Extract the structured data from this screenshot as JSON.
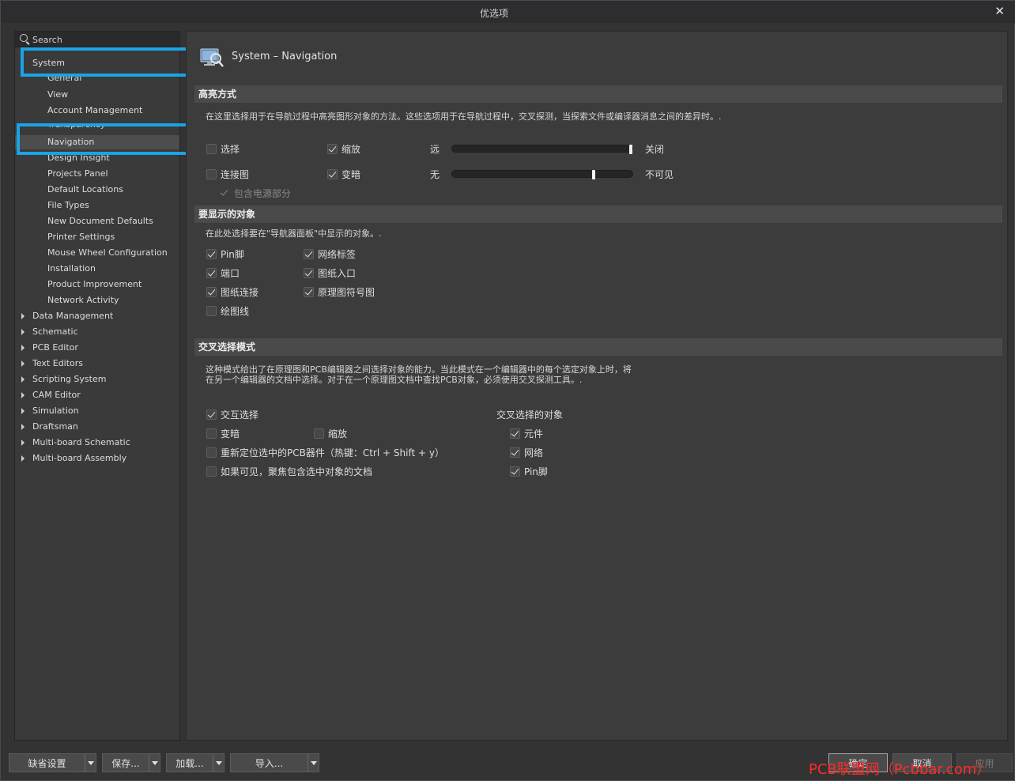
{
  "window": {
    "title": "优选项"
  },
  "search": {
    "placeholder": "Search"
  },
  "tree": {
    "system": "System",
    "children": [
      "General",
      "View",
      "Account Management",
      "Transparency",
      "Navigation",
      "Design Insight",
      "Projects Panel",
      "Default Locations",
      "File Types",
      "New Document Defaults",
      "Printer Settings",
      "Mouse Wheel Configuration",
      "Installation",
      "Product Improvement",
      "Network Activity"
    ],
    "roots": [
      "Data Management",
      "Schematic",
      "PCB Editor",
      "Text Editors",
      "Scripting System",
      "CAM Editor",
      "Simulation",
      "Draftsman",
      "Multi-board Schematic",
      "Multi-board Assembly"
    ]
  },
  "page": {
    "title": "System – Navigation"
  },
  "highlight": {
    "header": "高亮方式",
    "desc": "在这里选择用于在导航过程中高亮图形对象的方法。这些选项用于在导航过程中，交叉探测，当探索文件或编译器消息之间的差异时。.",
    "select": "选择",
    "zoom": "缩放",
    "connection": "连接图",
    "dim": "变暗",
    "far": "远",
    "off": "关闭",
    "none": "无",
    "invisible": "不可见",
    "include_power": "包含电源部分",
    "zoom_level": 1.0,
    "dim_level": 0.79
  },
  "objects": {
    "header": "要显示的对象",
    "desc": "在此处选择要在\"导航器面板\"中显示的对象。.",
    "pin": "Pin脚",
    "net_label": "网络标签",
    "port": "端口",
    "sheet_entry": "图纸入口",
    "sheet_connector": "图纸连接",
    "sheet_symbol": "原理图符号图",
    "graphic_line": "绘图线"
  },
  "cross": {
    "header": "交叉选择模式",
    "desc1": "这种模式给出了在原理图和PCB编辑器之间选择对象的能力。当此模式在一个编辑器中的每个选定对象上时，将",
    "desc2": "在另一个编辑器的文档中选择。对于在一个原理图文档中查找PCB对象，必须使用交叉探测工具。.",
    "interactive": "交互选择",
    "objects_title": "交叉选择的对象",
    "dim": "变暗",
    "zoom": "缩放",
    "component": "元件",
    "reposition": "重新定位选中的PCB器件（热键：Ctrl + Shift + y）",
    "net": "网络",
    "focus": "如果可见，聚焦包含选中对象的文档",
    "pin": "Pin脚"
  },
  "buttons": {
    "defaults": "缺省设置",
    "save": "保存...",
    "load": "加载...",
    "import": "导入...",
    "ok": "确定",
    "cancel": "取消",
    "apply": "应用"
  },
  "watermark": "PCB联盟网（Pcbbar.com）",
  "colors": {
    "highlight_box": "#1aa3e8",
    "watermark": "#ff2a2a"
  }
}
